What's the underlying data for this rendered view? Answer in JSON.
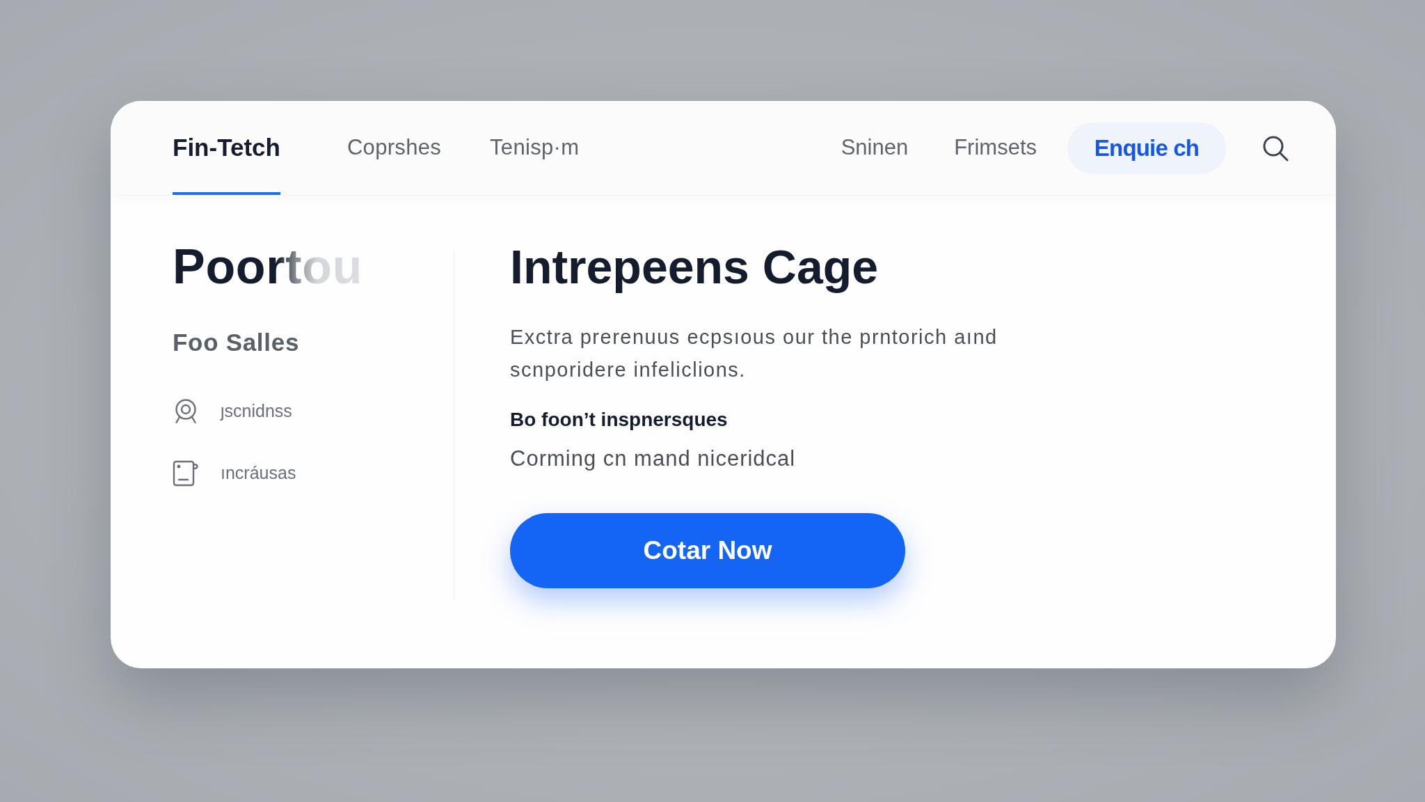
{
  "nav": {
    "tabs": [
      {
        "label": "Fin-Tetch",
        "selected": true
      },
      {
        "label": "Coprshes",
        "selected": false
      },
      {
        "label": "Tenisp·m",
        "selected": false
      }
    ],
    "links": [
      "Sninen",
      "Frimsets"
    ],
    "cta": "Enquie ch"
  },
  "sidebar": {
    "title": "Poortou",
    "subtitle": "Foo Salles",
    "items": [
      {
        "kind": "webcam",
        "label": "ȷscnidnss"
      },
      {
        "kind": "note",
        "label": "ıncráusas"
      }
    ]
  },
  "main": {
    "title": "Intrepeens Cage",
    "description": "Exctra prerenuus ecpsıous our the prntorich aınd scnporidere infeliclions.",
    "subheading": "Bo foon’t inspnersques",
    "subtext": "Corming cn mand niceridcal",
    "button": "Cotar Now"
  }
}
